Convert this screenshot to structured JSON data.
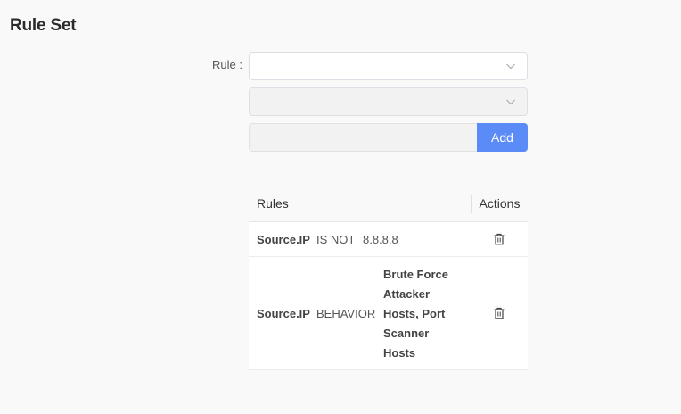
{
  "page": {
    "title": "Rule Set"
  },
  "form": {
    "rule_label": "Rule :",
    "rule_select_value": "",
    "operator_select_value": "",
    "value_input": "",
    "add_label": "Add"
  },
  "table": {
    "headers": {
      "rules": "Rules",
      "actions": "Actions"
    },
    "rows": [
      {
        "field": "Source.IP",
        "operator": "IS NOT",
        "value": "8.8.8.8",
        "action_icon": "trash-icon"
      },
      {
        "field": "Source.IP",
        "operator": "BEHAVIOR",
        "value": "Brute Force Attacker Hosts, Port Scanner Hosts",
        "action_icon": "trash-icon"
      }
    ]
  },
  "colors": {
    "accent": "#5a8bf7",
    "background": "#f9f9f9",
    "disabled_field": "#f2f2f2"
  }
}
